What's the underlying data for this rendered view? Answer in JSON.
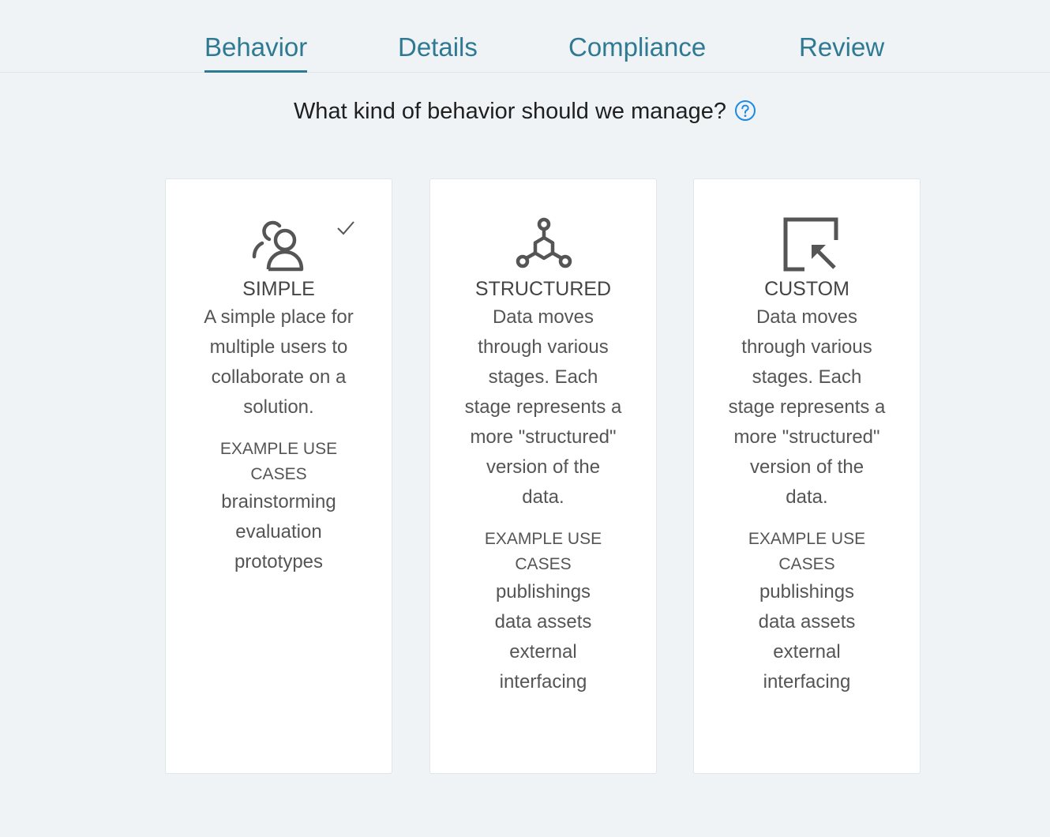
{
  "tabs": [
    {
      "label": "Behavior",
      "active": true
    },
    {
      "label": "Details",
      "active": false
    },
    {
      "label": "Compliance",
      "active": false
    },
    {
      "label": "Review",
      "active": false
    }
  ],
  "question": {
    "text": "What kind of behavior should we manage?",
    "help_icon": "question-circle-icon"
  },
  "colors": {
    "accent": "#2f7a93",
    "help": "#1c8ae6",
    "background": "#eff3f6",
    "card": "#ffffff",
    "icon": "#555555"
  },
  "cards": [
    {
      "id": "simple",
      "icon": "users-icon",
      "selected": true,
      "title": "SIMPLE",
      "description": "A simple place for multiple users to collaborate on a solution.",
      "example_label": "EXAMPLE USE CASES",
      "examples": [
        "brainstorming",
        "evaluation",
        "prototypes"
      ]
    },
    {
      "id": "structured",
      "icon": "network-icon",
      "selected": false,
      "title": "STRUCTURED",
      "description": "Data moves through various stages. Each stage represents a more \"structured\" version of the data.",
      "example_label": "EXAMPLE USE CASES",
      "examples": [
        "publishings",
        "data assets",
        "external",
        "interfacing"
      ]
    },
    {
      "id": "custom",
      "icon": "arrow-box-icon",
      "selected": false,
      "title": "CUSTOM",
      "description": "Data moves through various stages. Each stage represents a more \"structured\" version of the data.",
      "example_label": "EXAMPLE USE CASES",
      "examples": [
        "publishings",
        "data assets",
        "external",
        "interfacing"
      ]
    }
  ]
}
